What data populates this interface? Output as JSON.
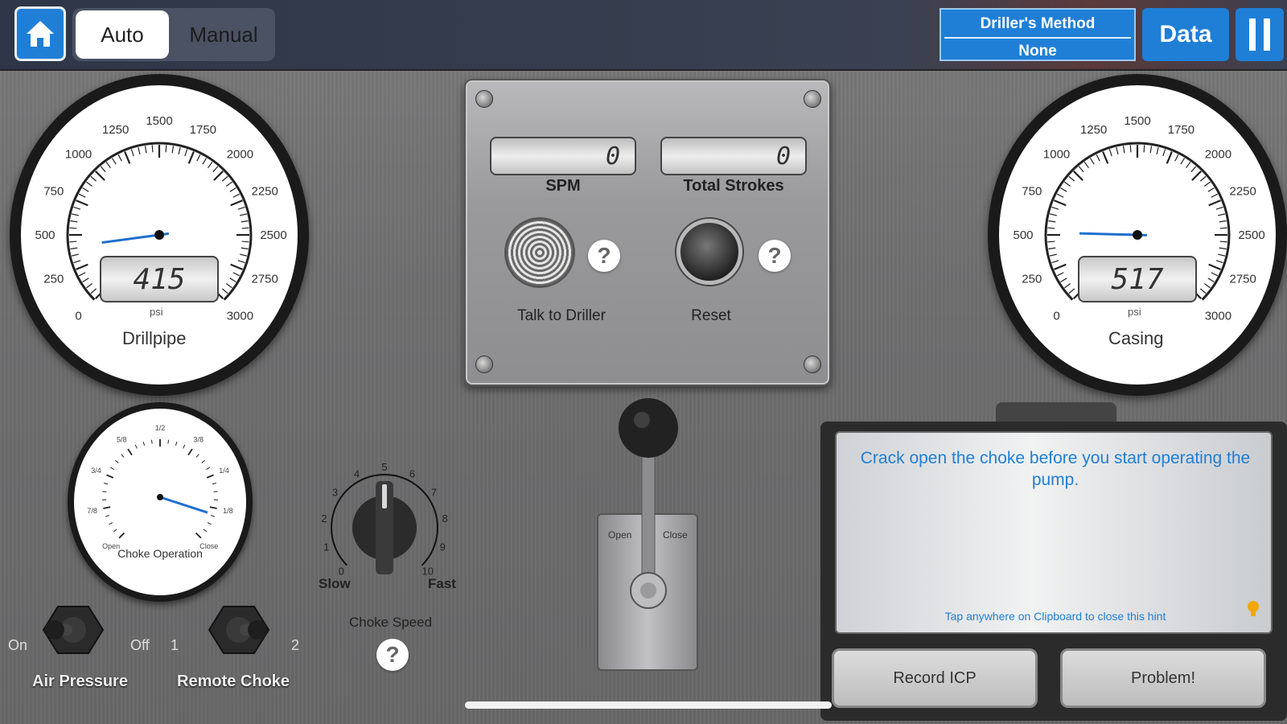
{
  "topbar": {
    "home_icon": "home-icon",
    "modes": {
      "auto": "Auto",
      "manual": "Manual",
      "selected": "Auto"
    },
    "method": {
      "title": "Driller's Method",
      "value": "None"
    },
    "data_label": "Data",
    "pause_icon": "pause-icon"
  },
  "drillpipe_gauge": {
    "label": "Drillpipe",
    "unit": "psi",
    "value": "415",
    "ticks": [
      "0",
      "250",
      "500",
      "750",
      "1000",
      "1250",
      "1500",
      "1750",
      "2000",
      "2250",
      "2500",
      "2750",
      "3000"
    ]
  },
  "casing_gauge": {
    "label": "Casing",
    "unit": "psi",
    "value": "517",
    "ticks": [
      "0",
      "250",
      "500",
      "750",
      "1000",
      "1250",
      "1500",
      "1750",
      "2000",
      "2250",
      "2500",
      "2750",
      "3000"
    ]
  },
  "pump_panel": {
    "spm_value": "0",
    "spm_label": "SPM",
    "strokes_value": "0",
    "strokes_label": "Total Strokes",
    "talk_label": "Talk to Driller",
    "reset_label": "Reset",
    "help_glyph": "?"
  },
  "choke_operation": {
    "label": "Choke Operation",
    "ticks": [
      "Open",
      "7/8",
      "3/4",
      "5/8",
      "1/2",
      "3/8",
      "1/4",
      "1/8",
      "Close"
    ]
  },
  "choke_speed": {
    "label": "Choke Speed",
    "ticks": [
      "0",
      "1",
      "2",
      "3",
      "4",
      "5",
      "6",
      "7",
      "8",
      "9",
      "10"
    ],
    "slow": "Slow",
    "fast": "Fast",
    "help_glyph": "?"
  },
  "air_pressure": {
    "label": "Air Pressure",
    "on": "On",
    "off": "Off"
  },
  "remote_choke": {
    "label": "Remote Choke",
    "one": "1",
    "two": "2"
  },
  "choke_lever": {
    "open": "Open",
    "close": "Close"
  },
  "clipboard": {
    "hint": "Crack open the choke before you start operating the pump.",
    "close_hint": "Tap anywhere on Clipboard to close this hint",
    "bulb_icon": "lightbulb-icon",
    "record_label": "Record ICP",
    "problem_label": "Problem!"
  }
}
